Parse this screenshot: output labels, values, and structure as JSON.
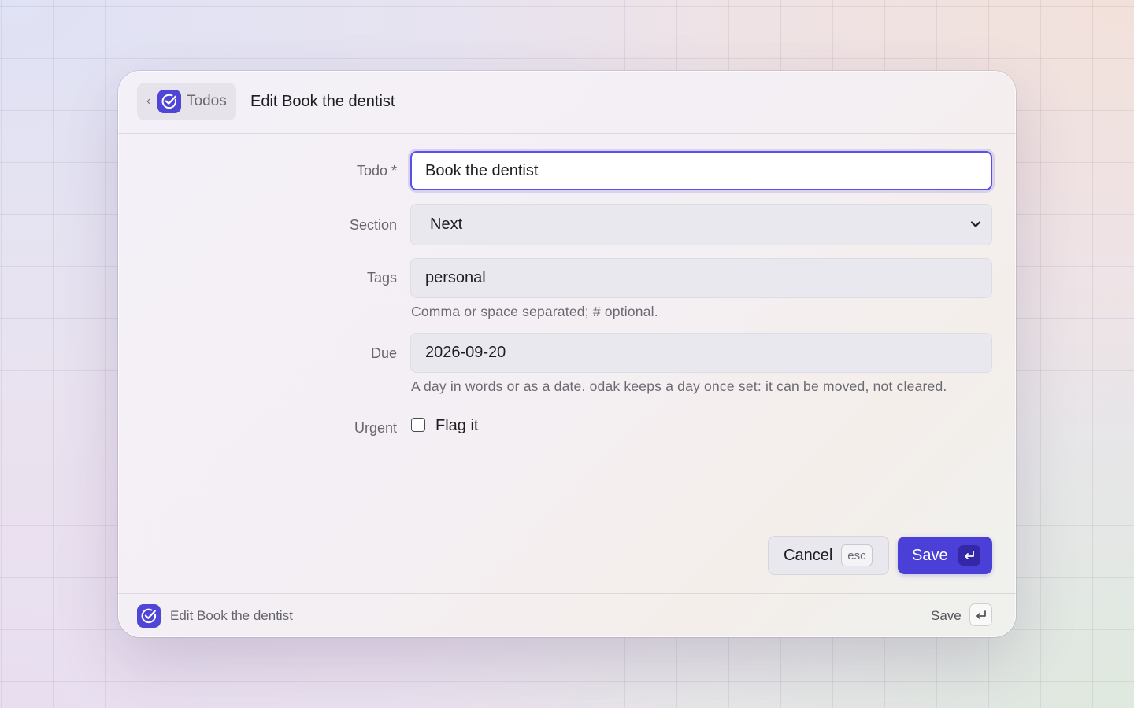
{
  "header": {
    "back_label": "Todos",
    "title": "Edit Book the dentist"
  },
  "form": {
    "todo": {
      "label": "Todo *",
      "value": "Book the dentist"
    },
    "section": {
      "label": "Section",
      "value": "Next"
    },
    "tags": {
      "label": "Tags",
      "value": "personal",
      "hint": "Comma or space separated; # optional."
    },
    "due": {
      "label": "Due",
      "value": "2026-09-20",
      "hint": "A day in words or as a date. odak keeps a day once set: it can be moved, not cleared."
    },
    "urgent": {
      "label": "Urgent",
      "checkbox_label": "Flag it",
      "checked": false
    }
  },
  "actions": {
    "cancel_label": "Cancel",
    "cancel_shortcut": "esc",
    "save_label": "Save",
    "save_shortcut_icon": "return-key-icon"
  },
  "footer": {
    "title": "Edit Book the dentist",
    "save_label": "Save",
    "save_shortcut_icon": "return-key-icon"
  },
  "colors": {
    "accent": "#4a3fd6",
    "focus_ring": "#5a50e6",
    "app_icon": "#5046d6"
  },
  "icons": {
    "app": "check-circle-icon",
    "back": "chevron-left-icon",
    "select": "chevron-down-icon"
  }
}
